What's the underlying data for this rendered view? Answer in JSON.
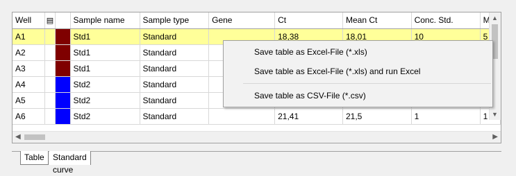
{
  "table": {
    "columns": [
      "Well",
      "",
      "Sample name",
      "Sample type",
      "Gene",
      "Ct",
      "Mean Ct",
      "Conc. Std.",
      "M"
    ],
    "grid_icon": "▤",
    "rows": [
      {
        "well": "A1",
        "color": "#7f0000",
        "sample_name": "Std1",
        "sample_type": "Standard",
        "gene": "",
        "ct": "18,38",
        "mean_ct": "18,01",
        "conc_std": "10",
        "m": "5",
        "selected": true
      },
      {
        "well": "A2",
        "color": "#7f0000",
        "sample_name": "Std1",
        "sample_type": "Standard",
        "gene": "",
        "ct": "",
        "mean_ct": "",
        "conc_std": "",
        "m": ""
      },
      {
        "well": "A3",
        "color": "#7f0000",
        "sample_name": "Std1",
        "sample_type": "Standard",
        "gene": "",
        "ct": "",
        "mean_ct": "",
        "conc_std": "",
        "m": ""
      },
      {
        "well": "A4",
        "color": "#0000ff",
        "sample_name": "Std2",
        "sample_type": "Standard",
        "gene": "",
        "ct": "",
        "mean_ct": "",
        "conc_std": "",
        "m": ""
      },
      {
        "well": "A5",
        "color": "#0000ff",
        "sample_name": "Std2",
        "sample_type": "Standard",
        "gene": "",
        "ct": "",
        "mean_ct": "",
        "conc_std": "",
        "m": ""
      },
      {
        "well": "A6",
        "color": "#0000ff",
        "sample_name": "Std2",
        "sample_type": "Standard",
        "gene": "",
        "ct": "21,41",
        "mean_ct": "21,5",
        "conc_std": "1",
        "m": "1"
      }
    ]
  },
  "context_menu": {
    "items": [
      "Save table as Excel-File (*.xls)",
      "Save table as Excel-File (*.xls) and run Excel",
      "Save table as CSV-File (*.csv)"
    ]
  },
  "tabs": [
    "Table",
    "Standard curve"
  ],
  "scrollbars": {
    "up": "▲",
    "down": "▼",
    "left": "◀",
    "right": "▶"
  }
}
